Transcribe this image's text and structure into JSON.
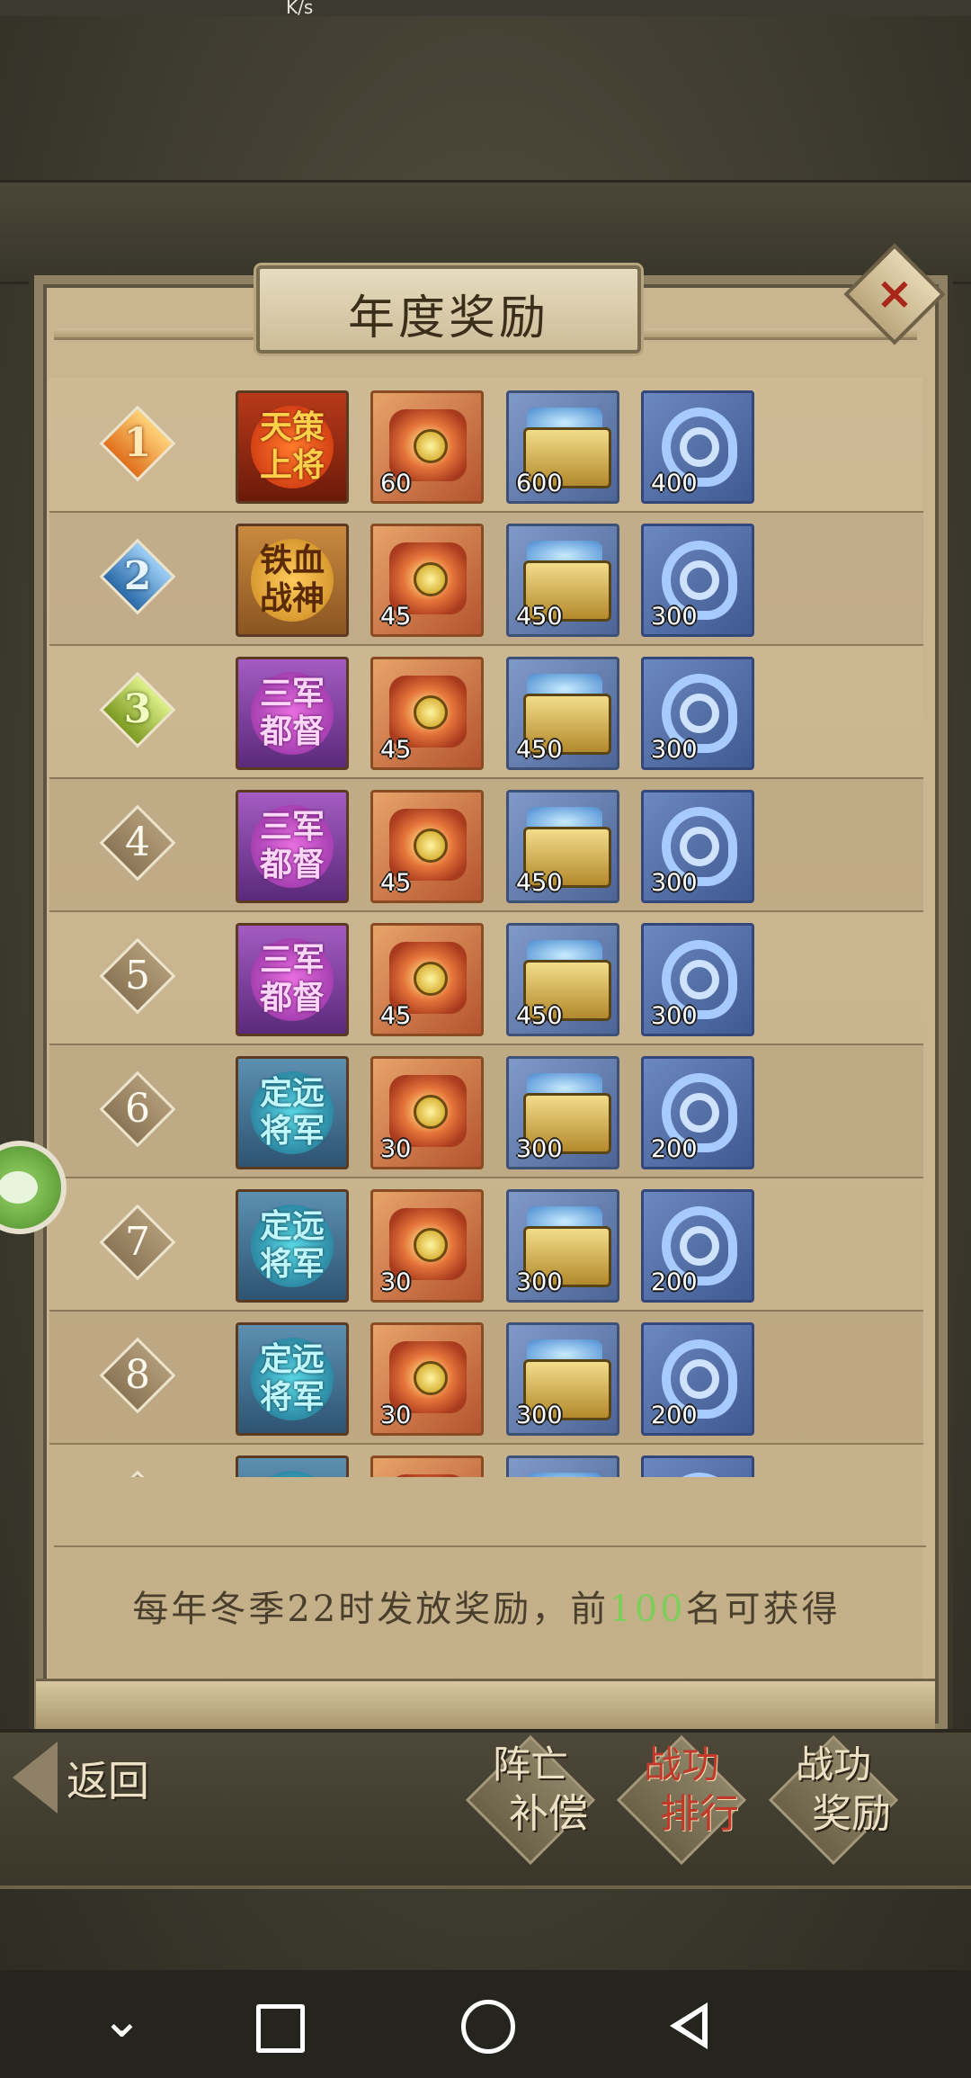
{
  "status_bar": {
    "speed_unit": "K/s"
  },
  "dialog": {
    "title": "年度奖励",
    "close_label": "×",
    "footer_text_before": "每年冬季22时发放奖励，前",
    "footer_text_highlight": "100",
    "footer_text_after": "名可获得"
  },
  "rewards": [
    {
      "rank": "1",
      "rank_style": "gold",
      "title_line1": "天策",
      "title_line2": "上将",
      "title_color": "red",
      "pouch": "60",
      "chest": "600",
      "dragon": "400"
    },
    {
      "rank": "2",
      "rank_style": "silver",
      "title_line1": "铁血",
      "title_line2": "战神",
      "title_color": "orange",
      "pouch": "45",
      "chest": "450",
      "dragon": "300"
    },
    {
      "rank": "3",
      "rank_style": "bronze",
      "title_line1": "三军",
      "title_line2": "都督",
      "title_color": "purple",
      "pouch": "45",
      "chest": "450",
      "dragon": "300"
    },
    {
      "rank": "4",
      "rank_style": "plain",
      "title_line1": "三军",
      "title_line2": "都督",
      "title_color": "purple",
      "pouch": "45",
      "chest": "450",
      "dragon": "300"
    },
    {
      "rank": "5",
      "rank_style": "plain",
      "title_line1": "三军",
      "title_line2": "都督",
      "title_color": "purple",
      "pouch": "45",
      "chest": "450",
      "dragon": "300"
    },
    {
      "rank": "6",
      "rank_style": "plain",
      "title_line1": "定远",
      "title_line2": "将军",
      "title_color": "teal",
      "pouch": "30",
      "chest": "300",
      "dragon": "200"
    },
    {
      "rank": "7",
      "rank_style": "plain",
      "title_line1": "定远",
      "title_line2": "将军",
      "title_color": "teal",
      "pouch": "30",
      "chest": "300",
      "dragon": "200"
    },
    {
      "rank": "8",
      "rank_style": "plain",
      "title_line1": "定远",
      "title_line2": "将军",
      "title_color": "teal",
      "pouch": "30",
      "chest": "300",
      "dragon": "200"
    },
    {
      "rank": "",
      "rank_style": "plain",
      "title_line1": "",
      "title_line2": "",
      "title_color": "teal",
      "pouch": "",
      "chest": "",
      "dragon": ""
    }
  ],
  "bottom_bar": {
    "back_label": "返回",
    "tabs": [
      {
        "line1": "阵亡",
        "line2": "补偿",
        "active": false
      },
      {
        "line1": "战功",
        "line2": "排行",
        "active": true
      },
      {
        "line1": "战功",
        "line2": "奖励",
        "active": false
      }
    ]
  },
  "icons": {
    "close": "close-icon",
    "back": "back-arrow-icon",
    "pouch": "red-pouch-icon",
    "chest": "treasure-chest-icon",
    "dragon": "blue-dragon-icon",
    "chat": "chat-bubble-icon"
  }
}
